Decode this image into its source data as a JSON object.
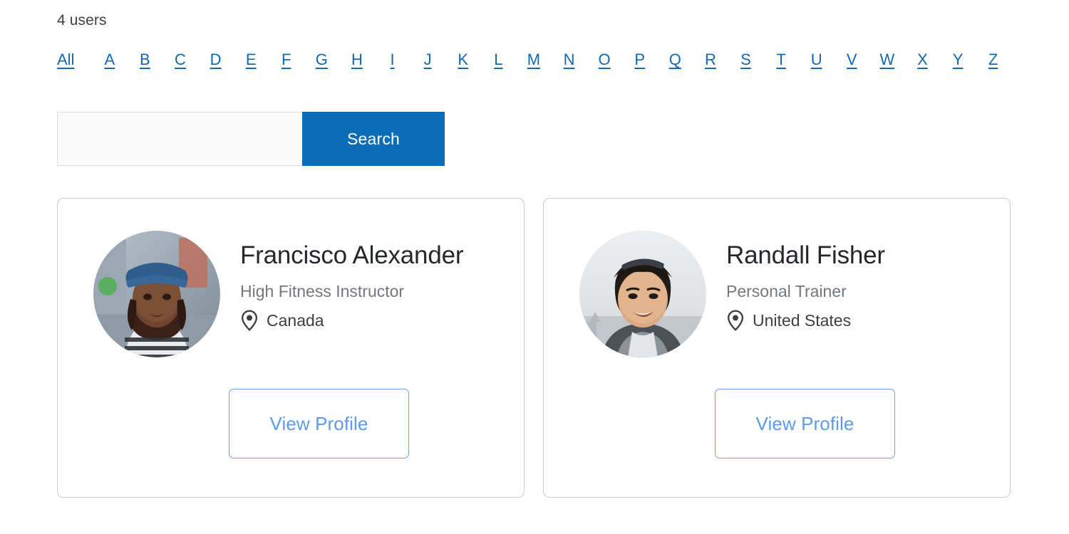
{
  "header": {
    "user_count_label": "4 users"
  },
  "alpha_nav": {
    "items": [
      "All",
      "A",
      "B",
      "C",
      "D",
      "E",
      "F",
      "G",
      "H",
      "I",
      "J",
      "K",
      "L",
      "M",
      "N",
      "O",
      "P",
      "Q",
      "R",
      "S",
      "T",
      "U",
      "V",
      "W",
      "X",
      "Y",
      "Z"
    ],
    "active": "All",
    "link_color": "#1168b3"
  },
  "search": {
    "value": "",
    "placeholder": "",
    "button_label": "Search",
    "button_color": "#0b6db6"
  },
  "cards": [
    {
      "name": "Francisco Alexander",
      "role": "High Fitness Instructor",
      "location": "Canada",
      "location_icon": "map-pin-icon",
      "button_label": "View Profile",
      "avatar_icon": "user-avatar-photo"
    },
    {
      "name": "Randall Fisher",
      "role": "Personal Trainer",
      "location": "United States",
      "location_icon": "map-pin-icon",
      "button_label": "View Profile",
      "avatar_icon": "user-avatar-photo"
    }
  ],
  "theme": {
    "card_border": "#c9ccd1",
    "outline_button_color": "#5b9bea",
    "text_primary": "#25282b",
    "text_secondary": "#73777c"
  }
}
